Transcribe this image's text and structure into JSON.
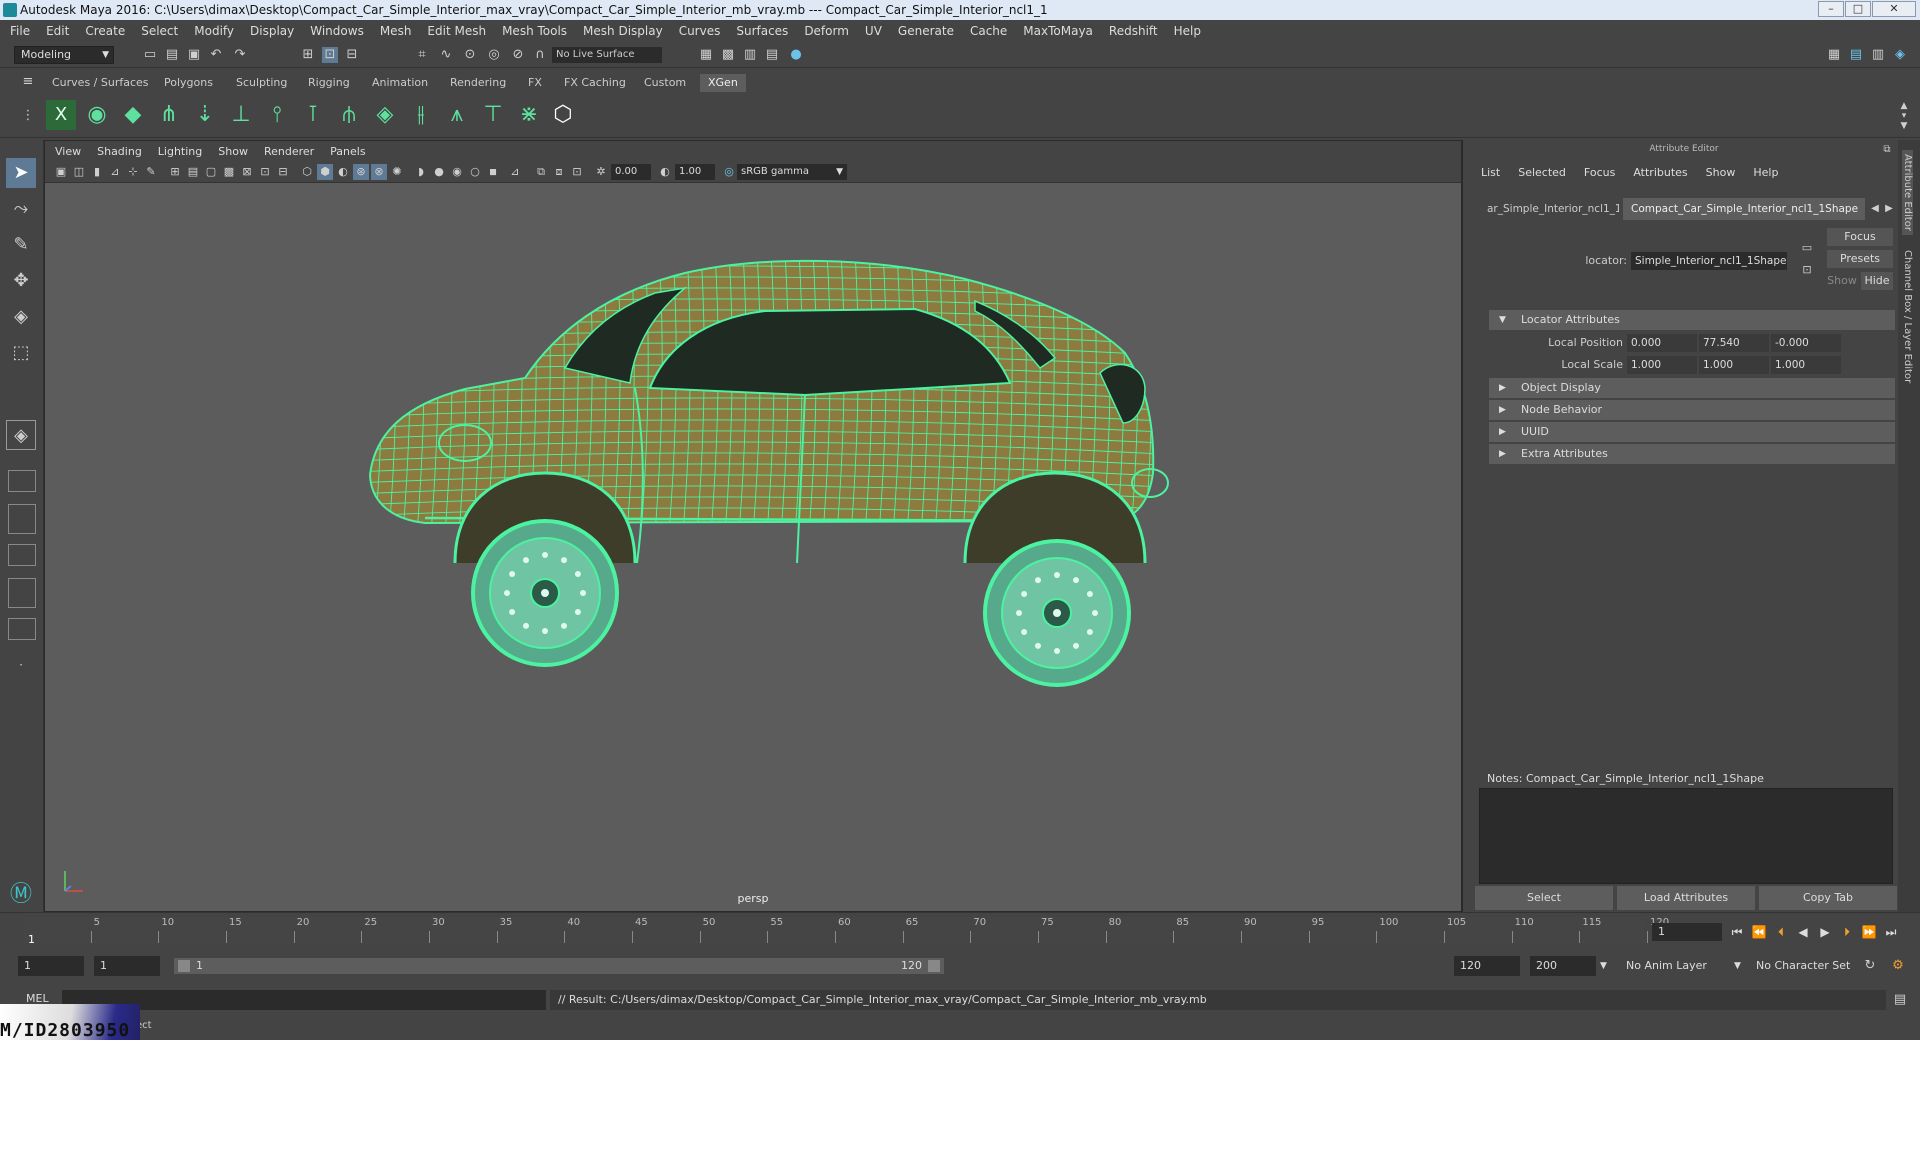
{
  "window": {
    "title": "Autodesk Maya 2016: C:\\Users\\dimax\\Desktop\\Compact_Car_Simple_Interior_max_vray\\Compact_Car_Simple_Interior_mb_vray.mb   ---   Compact_Car_Simple_Interior_ncl1_1"
  },
  "menubar": [
    "File",
    "Edit",
    "Create",
    "Select",
    "Modify",
    "Display",
    "Windows",
    "Mesh",
    "Edit Mesh",
    "Mesh Tools",
    "Mesh Display",
    "Curves",
    "Surfaces",
    "Deform",
    "UV",
    "Generate",
    "Cache",
    "MaxToMaya",
    "Redshift",
    "Help"
  ],
  "statusline": {
    "mode": "Modeling",
    "live_surface": "No Live Surface"
  },
  "shelf": {
    "tabs": [
      "Curves / Surfaces",
      "Polygons",
      "Sculpting",
      "Rigging",
      "Animation",
      "Rendering",
      "FX",
      "FX Caching",
      "Custom",
      "XGen"
    ],
    "active_tab": "XGen"
  },
  "viewport": {
    "menu": [
      "View",
      "Shading",
      "Lighting",
      "Show",
      "Renderer",
      "Panels"
    ],
    "exposure": "0.00",
    "gamma": "1.00",
    "color_space": "sRGB gamma",
    "camera_label": "persp",
    "wire_color": "#4cf2a0"
  },
  "attribute_editor": {
    "title": "Attribute Editor",
    "menu": [
      "List",
      "Selected",
      "Focus",
      "Attributes",
      "Show",
      "Help"
    ],
    "tabs": [
      "ar_Simple_Interior_ncl1_1",
      "Compact_Car_Simple_Interior_ncl1_1Shape"
    ],
    "focus_label": "Focus",
    "presets_label": "Presets",
    "show_label": "Show",
    "hide_label": "Hide",
    "locator_label": "locator:",
    "locator_value": "Simple_Interior_ncl1_1Shape",
    "sections": [
      {
        "label": "Locator Attributes",
        "expanded": true
      },
      {
        "label": "Object Display",
        "expanded": false
      },
      {
        "label": "Node Behavior",
        "expanded": false
      },
      {
        "label": "UUID",
        "expanded": false
      },
      {
        "label": "Extra Attributes",
        "expanded": false
      }
    ],
    "local_position": {
      "label": "Local Position",
      "values": [
        "0.000",
        "77.540",
        "-0.000"
      ]
    },
    "local_scale": {
      "label": "Local Scale",
      "values": [
        "1.000",
        "1.000",
        "1.000"
      ]
    },
    "notes_label": "Notes:  Compact_Car_Simple_Interior_ncl1_1Shape",
    "buttons": [
      "Select",
      "Load Attributes",
      "Copy Tab"
    ],
    "side_tabs": [
      "Attribute Editor",
      "Channel Box / Layer Editor"
    ]
  },
  "timeline": {
    "ticks": [
      "5",
      "10",
      "15",
      "20",
      "25",
      "30",
      "35",
      "40",
      "45",
      "50",
      "55",
      "60",
      "65",
      "70",
      "75",
      "80",
      "85",
      "90",
      "95",
      "100",
      "105",
      "110",
      "115",
      "120"
    ],
    "current_frame_marker": "1",
    "current_frame": "1"
  },
  "range": {
    "start": "1",
    "playback_start": "1",
    "slider_left": "1",
    "slider_right": "120",
    "playback_end": "120",
    "end": "200",
    "anim_layer": "No Anim Layer",
    "character_set": "No Character Set"
  },
  "command_line": {
    "lang": "MEL",
    "result": "// Result: C:/Users/dimax/Desktop/Compact_Car_Simple_Interior_max_vray/Compact_Car_Simple_Interior_mb_vray.mb"
  },
  "help_line": {
    "text": "ect"
  },
  "watermark": "M/ID2803950"
}
